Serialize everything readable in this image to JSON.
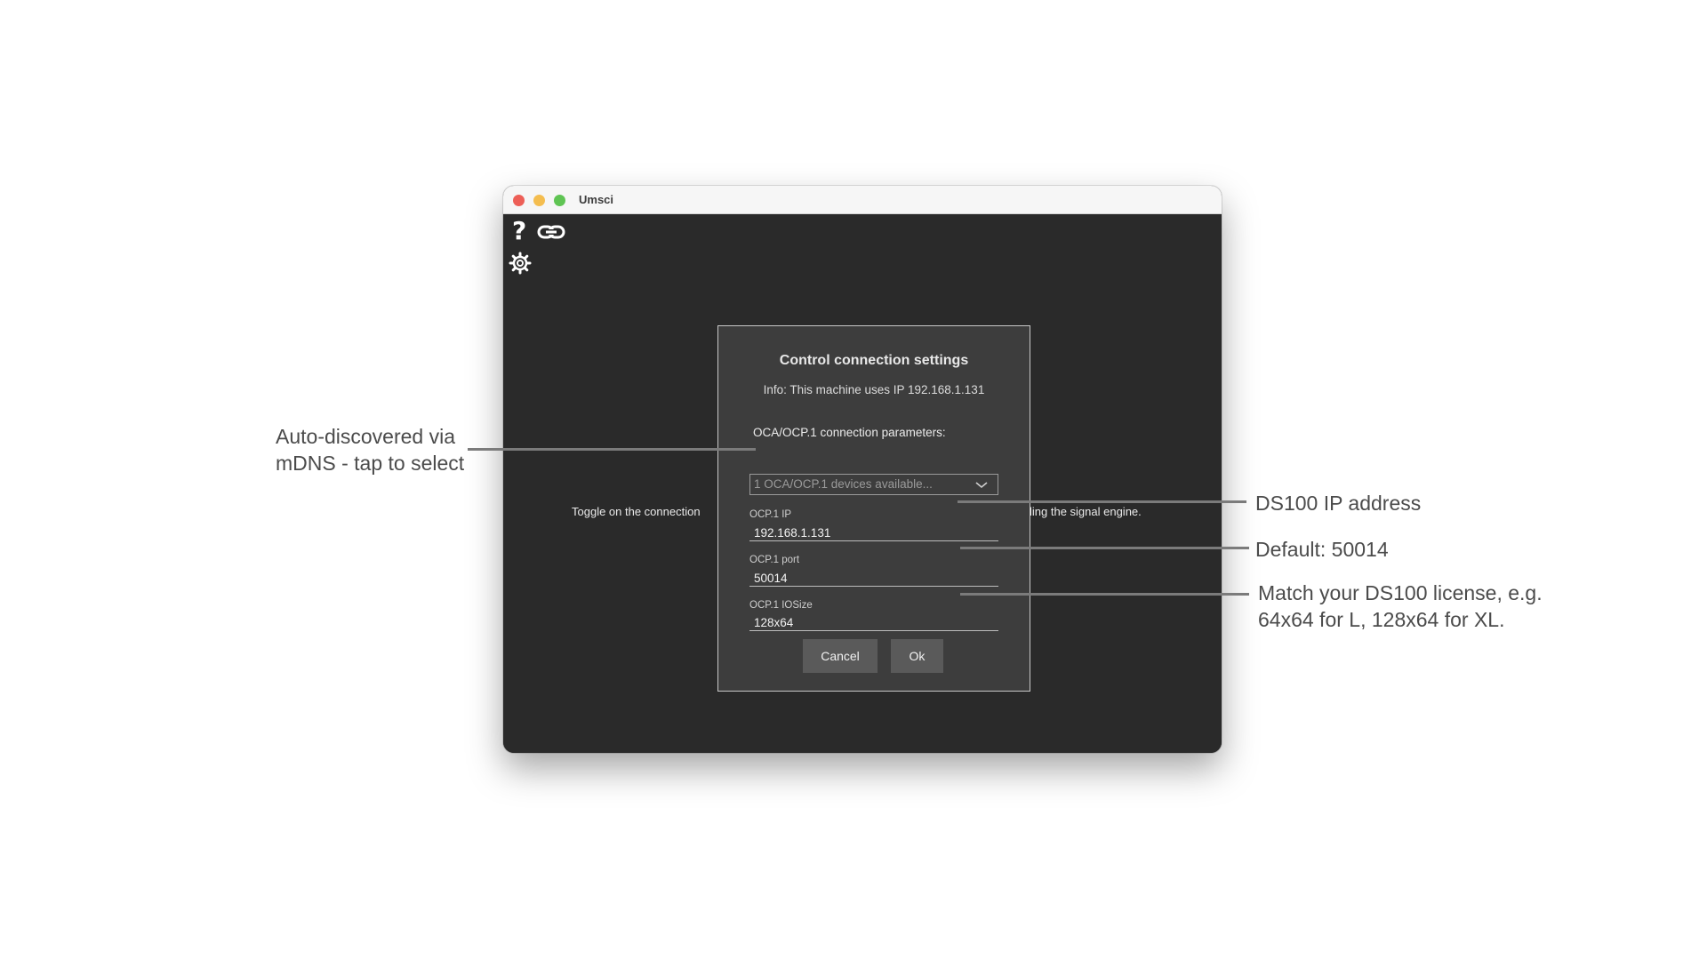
{
  "window": {
    "title": "Umsci"
  },
  "toolbar": {
    "help_icon": "help-icon",
    "link_icon": "link-icon",
    "settings_icon": "gear-icon"
  },
  "background": {
    "text_left": "Toggle on the connection",
    "text_right": "ling the signal engine."
  },
  "dialog": {
    "title": "Control connection settings",
    "info": "Info: This machine uses IP 192.168.1.131",
    "params_label": "OCA/OCP.1 connection parameters:",
    "device_select": {
      "placeholder": "1 OCA/OCP.1 devices available..."
    },
    "fields": {
      "ip": {
        "label": "OCP.1 IP",
        "value": "192.168.1.131"
      },
      "port": {
        "label": "OCP.1 port",
        "value": "50014"
      },
      "iosize": {
        "label": "OCP.1 IOSize",
        "value": "128x64"
      }
    },
    "buttons": {
      "cancel": "Cancel",
      "ok": "Ok"
    }
  },
  "annotations": {
    "mdns_line1": "Auto-discovered via",
    "mdns_line2": "mDNS - tap to select",
    "ip": "DS100 IP address",
    "port": "Default: 50014",
    "license_line1": "Match your DS100 license, e.g.",
    "license_line2": "64x64 for L, 128x64 for XL."
  }
}
